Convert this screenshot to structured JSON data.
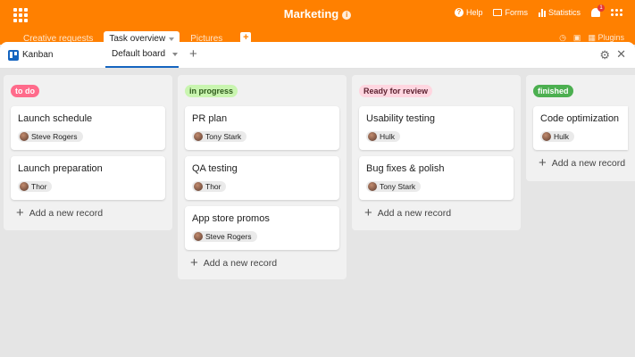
{
  "header": {
    "title": "Marketing",
    "actions": [
      {
        "name": "help",
        "label": "Help"
      },
      {
        "name": "forms",
        "label": "Forms"
      },
      {
        "name": "statistics",
        "label": "Statistics"
      }
    ],
    "notification_count": "1"
  },
  "tabs": [
    {
      "label": "Creative requests"
    },
    {
      "label": "Task overview"
    },
    {
      "label": "Pictures"
    }
  ],
  "tabs_right": {
    "plugins_label": "Plugins"
  },
  "view": {
    "type_label": "Kanban",
    "active_view": "Default board"
  },
  "add_record_label": "Add a new record",
  "columns": [
    {
      "tag": "to do",
      "tag_color": "#ff6b8b",
      "tag_text_color": "#ffffff",
      "cards": [
        {
          "title": "Launch schedule",
          "assignee": "Steve Rogers"
        },
        {
          "title": "Launch preparation",
          "assignee": "Thor"
        }
      ]
    },
    {
      "tag": "in progress",
      "tag_color": "#c9f5b0",
      "tag_text_color": "#2e5a1b",
      "cards": [
        {
          "title": "PR plan",
          "assignee": "Tony Stark"
        },
        {
          "title": "QA testing",
          "assignee": "Thor"
        },
        {
          "title": "App store promos",
          "assignee": "Steve Rogers"
        }
      ]
    },
    {
      "tag": "Ready for review",
      "tag_color": "#ffd6e0",
      "tag_text_color": "#5a1f2e",
      "cards": [
        {
          "title": "Usability testing",
          "assignee": "Hulk"
        },
        {
          "title": "Bug fixes & polish",
          "assignee": "Tony Stark"
        }
      ]
    },
    {
      "tag": "finished",
      "tag_color": "#4caf50",
      "tag_text_color": "#ffffff",
      "cards": [
        {
          "title": "Code optimization",
          "assignee": "Hulk"
        }
      ]
    }
  ]
}
